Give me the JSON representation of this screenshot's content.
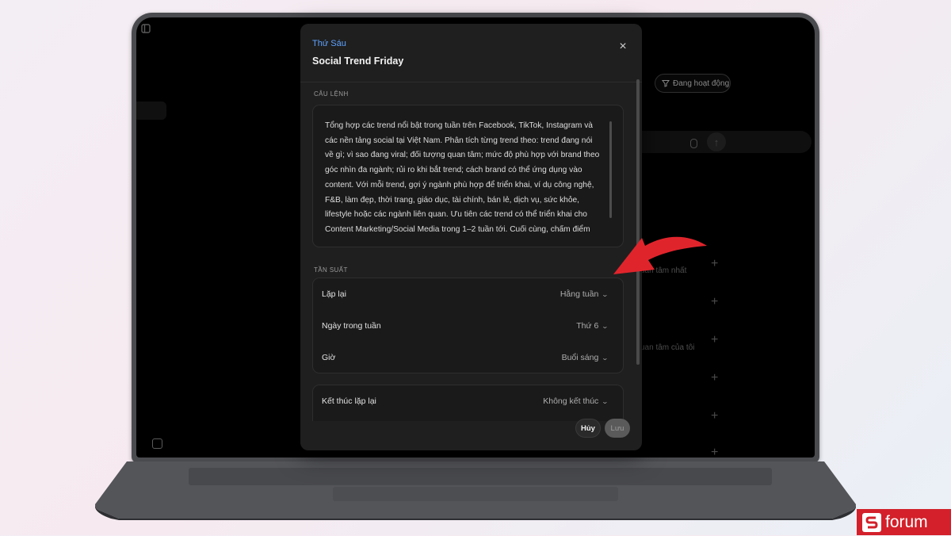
{
  "background_app": {
    "filter_button_label": "Đang hoạt động",
    "row_text_1": "uan tâm nhất",
    "row_text_2": "uan tâm của tôi",
    "plus_symbol": "+",
    "send_symbol": "↑"
  },
  "modal": {
    "day_label": "Thứ Sáu",
    "title": "Social Trend Friday",
    "close_symbol": "×",
    "prompt_section_label": "CÂU LỆNH",
    "prompt_text": "Tổng hợp các trend nổi bật trong tuần trên Facebook, TikTok, Instagram và các nền tảng social tại Việt Nam. Phân tích từng trend theo: trend đang nói về gì; vì sao đang viral; đối tượng quan tâm; mức độ phù hợp với brand theo góc nhìn đa ngành; rủi ro khi bắt trend; cách brand có thể ứng dụng vào content. Với mỗi trend, gợi ý ngành phù hợp để triển khai, ví dụ công nghệ, F&B, làm đẹp, thời trang, giáo dục, tài chính, bán lẻ, dịch vụ, sức khỏe, lifestyle hoặc các ngành liên quan. Ưu tiên các trend có thể triển khai cho Content Marketing/Social Media trong 1–2 tuần tới. Cuối cùng, chấm điểm từng trend",
    "frequency_section_label": "TẦN SUẤT",
    "settings": [
      {
        "label": "Lặp lại",
        "value": "Hằng tuần"
      },
      {
        "label": "Ngày trong tuần",
        "value": "Thứ 6"
      },
      {
        "label": "Giờ",
        "value": "Buổi sáng"
      }
    ],
    "end_repeat": {
      "label": "Kết thúc lặp lại",
      "value": "Không kết thúc"
    },
    "cancel_label": "Hủy",
    "save_label": "Lưu",
    "chevron_symbol": "⌄"
  },
  "watermark": {
    "brand": "forum"
  },
  "colors": {
    "accent_blue": "#5ea3ff",
    "arrow_red": "#e0242c",
    "brand_red": "#d3202a"
  }
}
